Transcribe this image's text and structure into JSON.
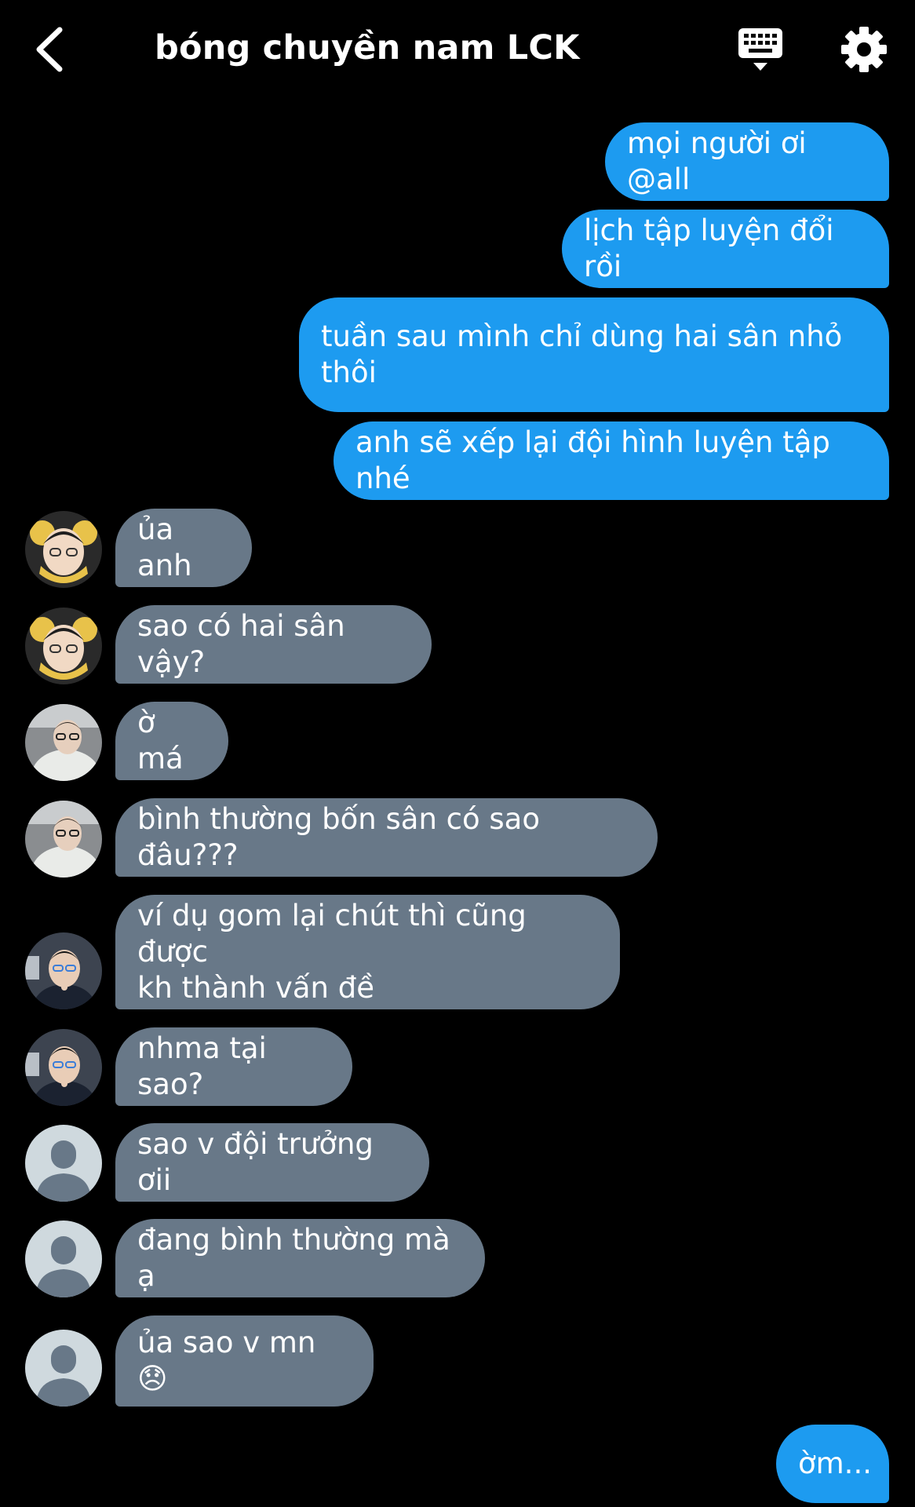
{
  "header": {
    "title": "bóng chuyền nam LCK",
    "back_icon": "chevron-left-icon",
    "keyboard_icon": "keyboard-icon",
    "settings_icon": "gear-icon"
  },
  "colors": {
    "background": "#000000",
    "outgoing_bubble": "#1d9bf0",
    "incoming_bubble": "#687888",
    "text": "#ffffff"
  },
  "messages": [
    {
      "direction": "out",
      "text": "mọi người ơi @all"
    },
    {
      "direction": "out",
      "text": "lịch tập luyện đổi rồi"
    },
    {
      "direction": "out",
      "text": "tuần sau mình chỉ dùng hai sân nhỏ\nthôi"
    },
    {
      "direction": "out",
      "text": "anh sẽ xếp lại đội hình luyện tập nhé"
    },
    {
      "direction": "in",
      "avatar": "user-photo-a",
      "text": "ủa anh"
    },
    {
      "direction": "in",
      "avatar": "user-photo-a",
      "text": "sao có hai sân vậy?"
    },
    {
      "direction": "in",
      "avatar": "user-photo-b",
      "text": "ờ má"
    },
    {
      "direction": "in",
      "avatar": "user-photo-b",
      "text": "bình thường bốn sân có sao đâu???"
    },
    {
      "direction": "in",
      "avatar": "user-photo-c",
      "text": "ví dụ gom lại chút thì cũng được\nkh thành vấn đề"
    },
    {
      "direction": "in",
      "avatar": "user-photo-c",
      "text": "nhma tại sao?"
    },
    {
      "direction": "in",
      "avatar": "default-avatar",
      "text": "sao v đội trưởng ơii"
    },
    {
      "direction": "in",
      "avatar": "default-avatar",
      "text": "đang bình thường mà ạ"
    },
    {
      "direction": "in",
      "avatar": "default-avatar",
      "text": "ủa sao v mn 😞"
    },
    {
      "direction": "out",
      "text": "ờm..."
    }
  ]
}
